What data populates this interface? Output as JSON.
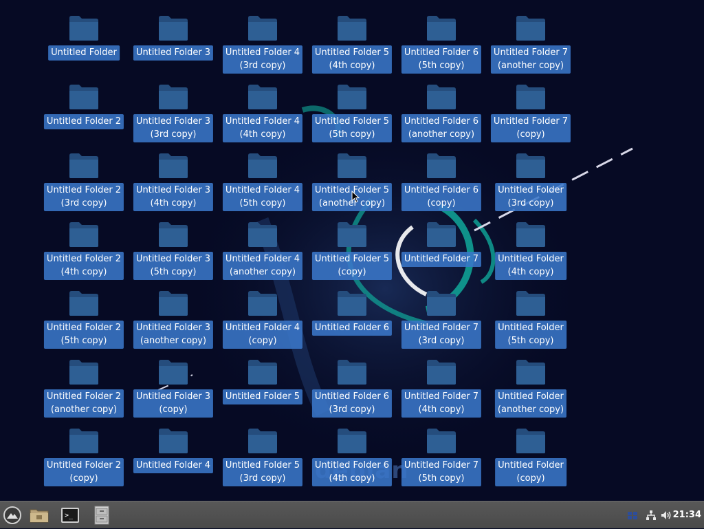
{
  "desktop": {
    "folders": [
      {
        "lines": [
          "Untitled Folder"
        ]
      },
      {
        "lines": [
          "Untitled Folder 3"
        ]
      },
      {
        "lines": [
          "Untitled Folder 4",
          "(3rd copy)"
        ]
      },
      {
        "lines": [
          "Untitled Folder 5",
          "(4th copy)"
        ]
      },
      {
        "lines": [
          "Untitled Folder 6",
          "(5th copy)"
        ]
      },
      {
        "lines": [
          "Untitled Folder 7",
          "(another copy)"
        ]
      },
      {
        "lines": [
          "Untitled Folder 2"
        ]
      },
      {
        "lines": [
          "Untitled Folder 3",
          "(3rd copy)"
        ]
      },
      {
        "lines": [
          "Untitled Folder 4",
          "(4th copy)"
        ]
      },
      {
        "lines": [
          "Untitled Folder 5",
          "(5th copy)"
        ]
      },
      {
        "lines": [
          "Untitled Folder 6",
          "(another copy)"
        ]
      },
      {
        "lines": [
          "Untitled Folder 7",
          "(copy)"
        ]
      },
      {
        "lines": [
          "Untitled Folder 2",
          "(3rd copy)"
        ]
      },
      {
        "lines": [
          "Untitled Folder 3",
          "(4th copy)"
        ]
      },
      {
        "lines": [
          "Untitled Folder 4",
          "(5th copy)"
        ]
      },
      {
        "lines": [
          "Untitled Folder 5",
          "(another copy)"
        ]
      },
      {
        "lines": [
          "Untitled Folder 6",
          "(copy)"
        ]
      },
      {
        "lines": [
          "Untitled Folder",
          "(3rd copy)"
        ]
      },
      {
        "lines": [
          "Untitled Folder 2",
          "(4th copy)"
        ]
      },
      {
        "lines": [
          "Untitled Folder 3",
          "(5th copy)"
        ]
      },
      {
        "lines": [
          "Untitled Folder 4",
          "(another copy)"
        ]
      },
      {
        "lines": [
          "Untitled Folder 5",
          "(copy)"
        ]
      },
      {
        "lines": [
          "Untitled Folder 7"
        ]
      },
      {
        "lines": [
          "Untitled Folder",
          "(4th copy)"
        ]
      },
      {
        "lines": [
          "Untitled Folder 2",
          "(5th copy)"
        ]
      },
      {
        "lines": [
          "Untitled Folder 3",
          "(another copy)"
        ]
      },
      {
        "lines": [
          "Untitled Folder 4",
          "(copy)"
        ]
      },
      {
        "lines": [
          "Untitled Folder 6"
        ]
      },
      {
        "lines": [
          "Untitled Folder 7",
          "(3rd copy)"
        ]
      },
      {
        "lines": [
          "Untitled Folder",
          "(5th copy)"
        ]
      },
      {
        "lines": [
          "Untitled Folder 2",
          "(another copy)"
        ]
      },
      {
        "lines": [
          "Untitled Folder 3",
          "(copy)"
        ]
      },
      {
        "lines": [
          "Untitled Folder 5"
        ]
      },
      {
        "lines": [
          "Untitled Folder 6",
          "(3rd copy)"
        ]
      },
      {
        "lines": [
          "Untitled Folder 7",
          "(4th copy)"
        ]
      },
      {
        "lines": [
          "Untitled Folder",
          "(another copy)"
        ]
      },
      {
        "lines": [
          "Untitled Folder 2",
          "(copy)"
        ]
      },
      {
        "lines": [
          "Untitled Folder 4"
        ]
      },
      {
        "lines": [
          "Untitled Folder 5",
          "(3rd copy)"
        ]
      },
      {
        "lines": [
          "Untitled Folder 6",
          "(4th copy)"
        ]
      },
      {
        "lines": [
          "Untitled Folder 7",
          "(5th copy)"
        ]
      },
      {
        "lines": [
          "Untitled Folder",
          "(copy)"
        ]
      }
    ],
    "wallpaper_text": "debian"
  },
  "panel": {
    "clock": "21:34",
    "launchers": [
      {
        "icon": "app-menu-icon"
      },
      {
        "icon": "file-manager-icon"
      },
      {
        "icon": "terminal-icon"
      },
      {
        "icon": "file-cabinet-icon"
      }
    ],
    "terminal_glyph": ">_",
    "tray": [
      {
        "icon": "workspace-icon"
      },
      {
        "icon": "network-icon"
      },
      {
        "icon": "volume-icon"
      }
    ]
  },
  "colors": {
    "background": "#060a24",
    "label_highlight": "#3a76c8",
    "folder": "#2e5f94",
    "swirl": "#10a89a",
    "panel": "#4f4f4f"
  }
}
